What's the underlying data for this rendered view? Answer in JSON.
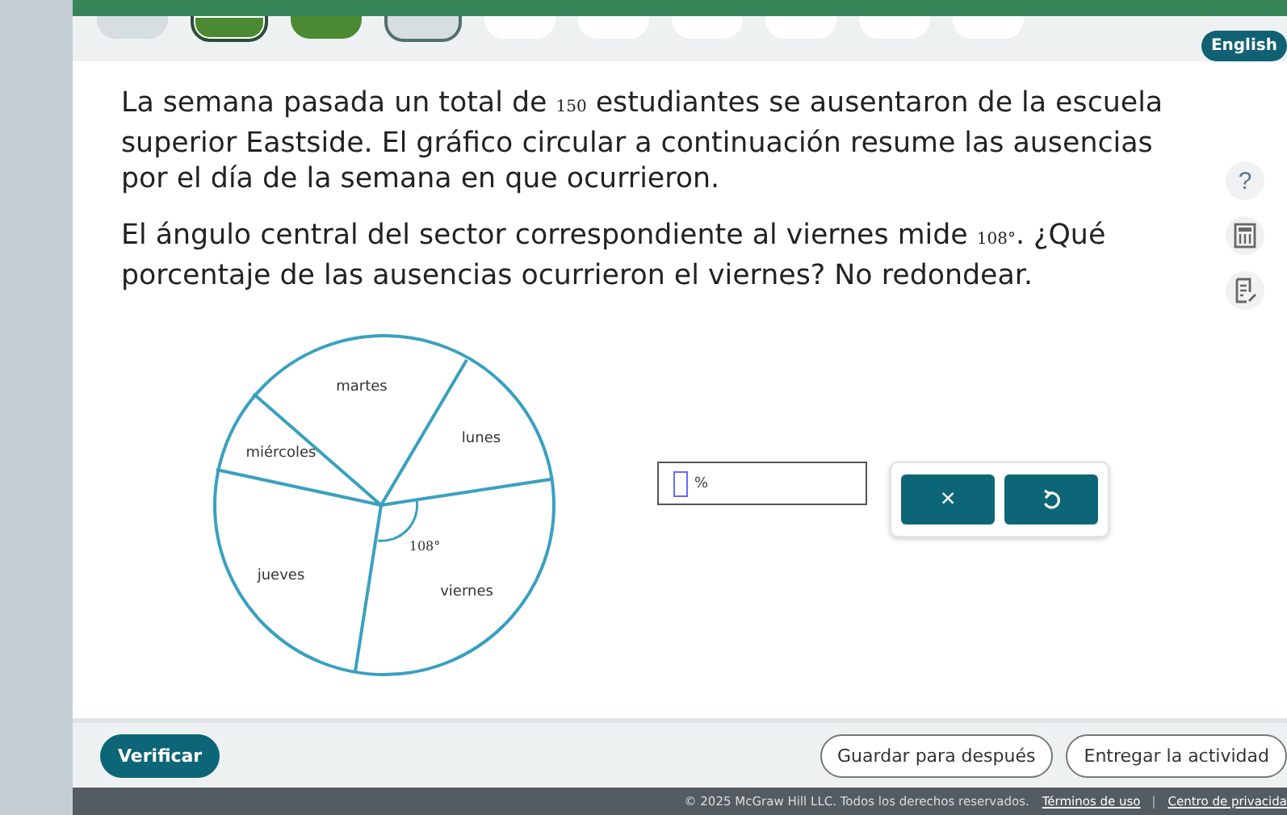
{
  "progress": [
    {
      "kind": "skipped",
      "selected": false
    },
    {
      "kind": "correct",
      "selected": true
    },
    {
      "kind": "correct",
      "selected": false
    },
    {
      "kind": "review",
      "selected": false
    },
    {
      "kind": "pending",
      "selected": false
    },
    {
      "kind": "pending",
      "selected": false
    },
    {
      "kind": "pending",
      "selected": false
    },
    {
      "kind": "pending",
      "selected": false
    },
    {
      "kind": "pending",
      "selected": false
    },
    {
      "kind": "pending",
      "selected": false
    }
  ],
  "language_button": "English",
  "question": [
    [
      {
        "text": "La semana pasada un total de "
      },
      {
        "text": "150",
        "kind": "math"
      },
      {
        "text": " estudiantes se ausentaron de la escuela superior Eastside. El gráfico circular a continuación resume las ausencias por el día de la semana en que ocurrieron."
      }
    ],
    [
      {
        "text": "El ángulo central del sector correspondiente al viernes mide "
      },
      {
        "text": "108°",
        "kind": "math"
      },
      {
        "text": ". ¿Qué porcentaje de las ausencias ocurrieron el viernes? No redondear."
      }
    ]
  ],
  "side_tools": [
    {
      "kind": "help",
      "label": "?"
    },
    {
      "kind": "calculator"
    },
    {
      "kind": "notes"
    }
  ],
  "pie": {
    "sectors": [
      "martes",
      "lunes",
      "miércoles",
      "jueves",
      "viernes"
    ],
    "angle_label": "108°"
  },
  "answer": {
    "unit": "%"
  },
  "answer_buttons": [
    {
      "kind": "clear",
      "label": "×"
    },
    {
      "kind": "reset"
    }
  ],
  "footer": {
    "check_button": "Verificar",
    "save_button": "Guardar para después",
    "submit_button": "Entregar la actividad"
  },
  "legal": {
    "copyright": "© 2025 McGraw Hill LLC. Todos los derechos reservados.",
    "links": [
      "Términos de uso",
      "Centro de privacida"
    ]
  }
}
